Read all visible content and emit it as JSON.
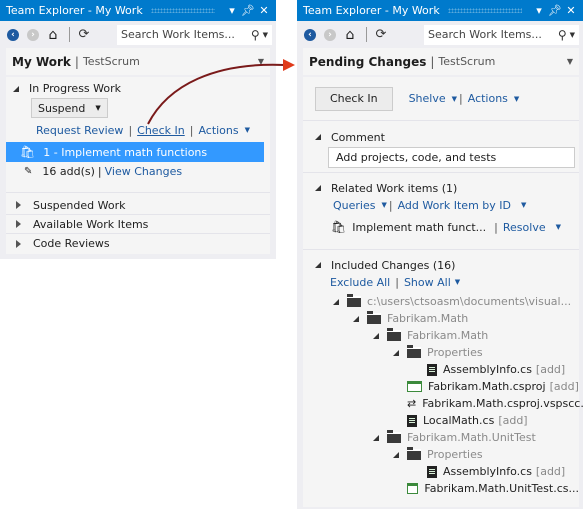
{
  "left_panel": {
    "title": "Team Explorer - My Work",
    "search_placeholder": "Search Work Items...",
    "header_title": "My Work",
    "header_project": "TestScrum",
    "in_progress": {
      "label": "In Progress Work",
      "suspend_label": "Suspend",
      "links": [
        "Request Review",
        "Check In",
        "Actions"
      ],
      "work_item": "1 - Implement math functions",
      "changes_count": "16 add(s)",
      "view_changes": "View Changes"
    },
    "collapsed_sections": [
      "Suspended Work",
      "Available Work Items",
      "Code Reviews"
    ]
  },
  "right_panel": {
    "title": "Team Explorer - My Work",
    "search_placeholder": "Search Work Items...",
    "header_title": "Pending Changes",
    "header_project": "TestScrum",
    "check_in_label": "Check In",
    "shelve_label": "Shelve",
    "actions_label": "Actions",
    "comment": {
      "label": "Comment",
      "value": "Add projects, code, and tests"
    },
    "related": {
      "label": "Related Work items (1)",
      "queries": "Queries",
      "add_by_id": "Add Work Item by ID",
      "item": "Implement math funct...",
      "resolve": "Resolve"
    },
    "included": {
      "label": "Included Changes (16)",
      "exclude_all": "Exclude All",
      "show_all": "Show All",
      "tree": [
        {
          "level": 0,
          "type": "folder",
          "name": "c:\\users\\ctsoasm\\documents\\visual...",
          "expanded": true
        },
        {
          "level": 1,
          "type": "folder",
          "name": "Fabrikam.Math",
          "expanded": true
        },
        {
          "level": 2,
          "type": "folder",
          "name": "Fabrikam.Math",
          "expanded": true
        },
        {
          "level": 3,
          "type": "folder",
          "name": "Properties",
          "expanded": true
        },
        {
          "level": 4,
          "type": "file",
          "name": "AssemblyInfo.cs",
          "status": "[add]"
        },
        {
          "level": 3,
          "type": "project",
          "name": "Fabrikam.Math.csproj",
          "status": "[add]"
        },
        {
          "level": 3,
          "type": "vspscc",
          "name": "Fabrikam.Math.csproj.vspscc...",
          "status": ""
        },
        {
          "level": 3,
          "type": "file",
          "name": "LocalMath.cs",
          "status": "[add]"
        },
        {
          "level": 2,
          "type": "folder",
          "name": "Fabrikam.Math.UnitTest",
          "expanded": true
        },
        {
          "level": 3,
          "type": "folder",
          "name": "Properties",
          "expanded": true
        },
        {
          "level": 4,
          "type": "file",
          "name": "AssemblyInfo.cs",
          "status": "[add]"
        },
        {
          "level": 3,
          "type": "project",
          "name": "Fabrikam.Math.UnitTest.cs...",
          "status": ""
        }
      ]
    }
  },
  "colors": {
    "titlebar": "#007acc",
    "selection": "#3399ff",
    "link": "#1e5aa0",
    "arrow": "#8b1a1a"
  }
}
